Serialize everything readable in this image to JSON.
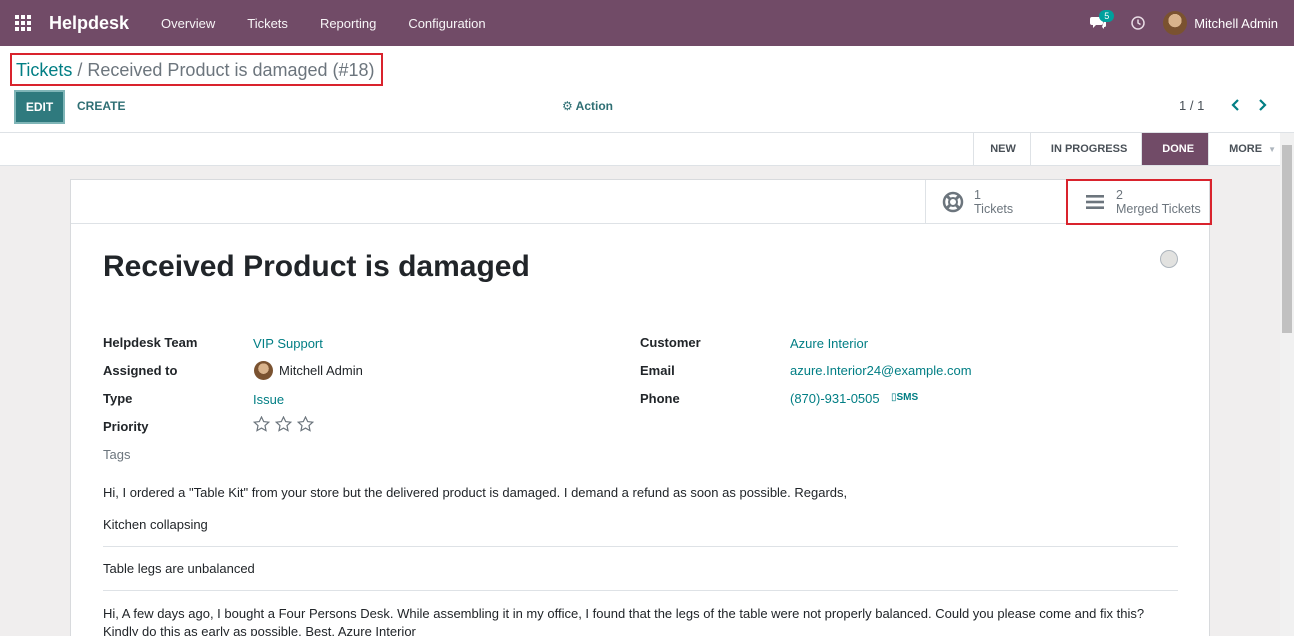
{
  "navbar": {
    "app_name": "Helpdesk",
    "menu": [
      "Overview",
      "Tickets",
      "Reporting",
      "Configuration"
    ],
    "chat_badge": "5",
    "user_name": "Mitchell Admin",
    "color": "#714b67"
  },
  "control_panel": {
    "breadcrumb_parent": "Tickets",
    "breadcrumb_separator": "/",
    "breadcrumb_current": "Received Product is damaged (#18)",
    "edit_label": "EDIT",
    "create_label": "CREATE",
    "action_label": "Action",
    "pager": "1 / 1"
  },
  "statusbar": {
    "stages": [
      "NEW",
      "IN PROGRESS",
      "DONE",
      "MORE"
    ],
    "active_stage": "DONE"
  },
  "smart_buttons": {
    "tickets_value": "1",
    "tickets_label": "Tickets",
    "merged_value": "2",
    "merged_label": "Merged Tickets"
  },
  "form": {
    "title": "Received Product is damaged",
    "left_fields": {
      "team_label": "Helpdesk Team",
      "team_value": "VIP Support",
      "assigned_label": "Assigned to",
      "assigned_value": "Mitchell Admin",
      "type_label": "Type",
      "type_value": "Issue",
      "priority_label": "Priority",
      "priority_stars": 0,
      "tags_label": "Tags"
    },
    "right_fields": {
      "customer_label": "Customer",
      "customer_value": "Azure Interior",
      "email_label": "Email",
      "email_value": "azure.Interior24@example.com",
      "phone_label": "Phone",
      "phone_value": "(870)-931-0505",
      "sms_label": "SMS"
    },
    "description": [
      "Hi, I ordered a \"Table Kit\" from your store but the delivered product is damaged. I demand a refund as soon as possible. Regards,",
      "Kitchen collapsing",
      "Table legs are unbalanced",
      "Hi, A few days ago, I bought a Four Persons Desk. While assembling it in my office, I found that the legs of the table were not properly balanced. Could you please come and fix this? Kindly do this as early as possible. Best, Azure Interior"
    ]
  }
}
